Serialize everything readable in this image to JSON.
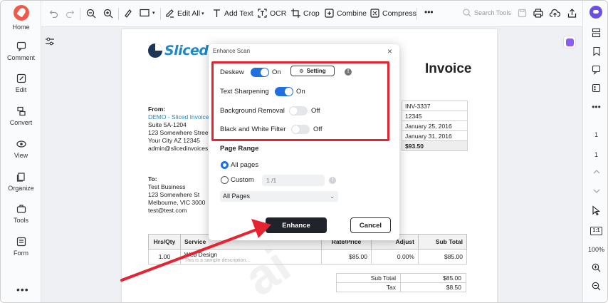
{
  "leftbar": {
    "items": [
      {
        "label": "Home",
        "icon": "home-icon"
      },
      {
        "label": "Comment",
        "icon": "comment-icon"
      },
      {
        "label": "Edit",
        "icon": "edit-icon"
      },
      {
        "label": "Convert",
        "icon": "convert-icon"
      },
      {
        "label": "View",
        "icon": "view-icon"
      },
      {
        "label": "Organize",
        "icon": "organize-icon"
      },
      {
        "label": "Tools",
        "icon": "tools-icon"
      },
      {
        "label": "Form",
        "icon": "form-icon"
      }
    ],
    "more": "•••"
  },
  "toolbar": {
    "edit_all": "Edit All",
    "add_text": "Add Text",
    "ocr": "OCR",
    "crop": "Crop",
    "combine": "Combine",
    "compress": "Compress",
    "more": "•••",
    "search_placeholder": "Search Tools"
  },
  "rightbar": {
    "page_current": "1",
    "page_total": "1",
    "zoom": "100%",
    "fit_label": "1:1"
  },
  "document": {
    "brand": "SlicedIn",
    "title": "Invoice",
    "from_label": "From:",
    "from_lines": [
      "DEMO - Sliced Invoices",
      "Suite 5A-1204",
      "123 Somewhere Street",
      "Your City AZ 12345",
      "admin@slicedinvoices.com"
    ],
    "to_label": "To:",
    "to_lines": [
      "Test Business",
      "123 Somewhere St",
      "Melbourne, VIC 3000",
      "test@test.com"
    ],
    "info_values": [
      "INV-3337",
      "12345",
      "January 25, 2016",
      "January 31, 2016",
      "$93.50"
    ],
    "items_headers": [
      "Hrs/Qty",
      "Service",
      "Rate/Price",
      "Adjust",
      "Sub Total"
    ],
    "item": {
      "qty": "1.00",
      "service": "Web Design",
      "description": "This is a sample description...",
      "rate": "$85.00",
      "adjust": "0.00%",
      "subtotal": "$85.00"
    },
    "totals": [
      {
        "label": "Sub Total",
        "value": "$85.00"
      },
      {
        "label": "Tax",
        "value": "$8.50"
      }
    ]
  },
  "dialog": {
    "title": "Enhance Scan",
    "close": "×",
    "options": [
      {
        "label": "Deskew",
        "state": "On",
        "on": true
      },
      {
        "label": "Text Sharpening",
        "state": "On",
        "on": true
      },
      {
        "label": "Background Removal",
        "state": "Off",
        "on": false
      },
      {
        "label": "Black and White Filter",
        "state": "Off",
        "on": false
      }
    ],
    "setting_label": "Setting",
    "page_range_title": "Page Range",
    "all_pages_label": "All pages",
    "custom_label": "Custom",
    "custom_placeholder": "1 /1",
    "select_value": "All Pages",
    "enhance_label": "Enhance",
    "cancel_label": "Cancel"
  },
  "colors": {
    "accent": "#1f6fe0",
    "highlight": "#e52331",
    "brand": "#1e88c9",
    "dark_button": "#20232a"
  }
}
